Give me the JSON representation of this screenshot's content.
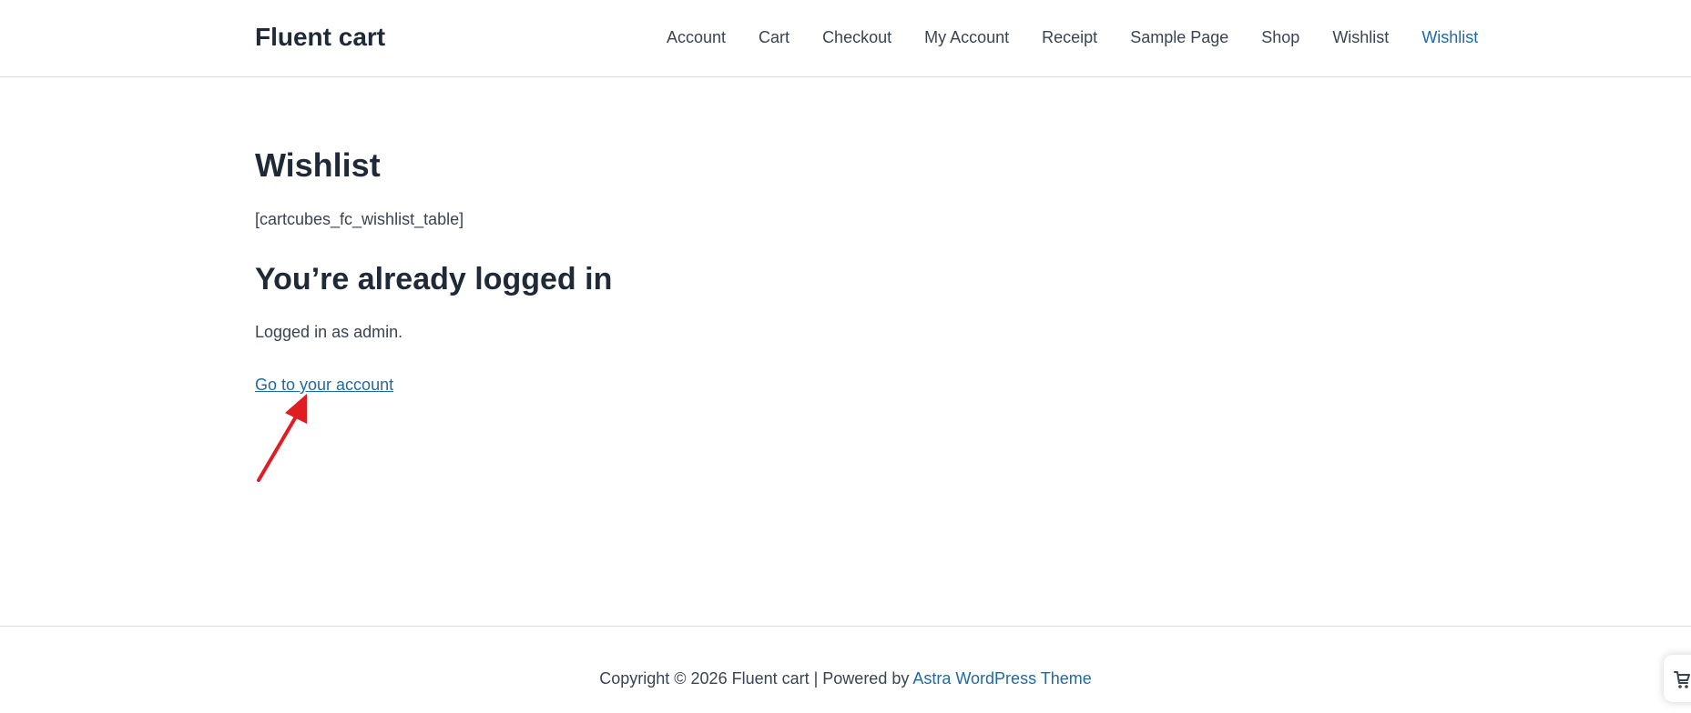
{
  "header": {
    "site_title": "Fluent cart",
    "nav": [
      {
        "label": "Account"
      },
      {
        "label": "Cart"
      },
      {
        "label": "Checkout"
      },
      {
        "label": "My Account"
      },
      {
        "label": "Receipt"
      },
      {
        "label": "Sample Page"
      },
      {
        "label": "Shop"
      },
      {
        "label": "Wishlist"
      },
      {
        "label": "Wishlist",
        "active": true
      }
    ]
  },
  "main": {
    "page_title": "Wishlist",
    "shortcode": "[cartcubes_fc_wishlist_table]",
    "section_title": "You’re already logged in",
    "logged_in_text": "Logged in as admin.",
    "account_link": "Go to your account"
  },
  "footer": {
    "copyright": "Copyright © 2026 Fluent cart | Powered by ",
    "theme_link": "Astra WordPress Theme"
  },
  "colors": {
    "accent": "#1f6aa5",
    "text": "#1f2937",
    "annotation": "#e11d24"
  },
  "icons": {
    "annotation": "arrow-icon",
    "floating_cart": "cart-icon"
  }
}
